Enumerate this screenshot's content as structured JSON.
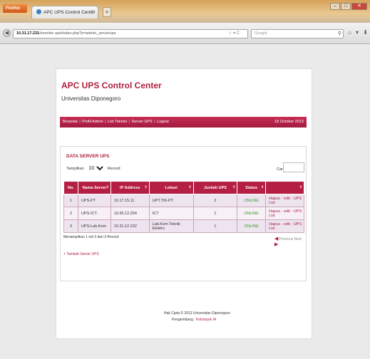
{
  "browser": {
    "app_button": "Firefox",
    "tab_title": "APC UPS Control Center",
    "tab_close": "×",
    "new_tab": "+",
    "url_host": "10.31.17.231",
    "url_path": "/monitor-ups/index.php?p=admin_serverups",
    "url_icons": "☆ ▾ C",
    "search_placeholder": "Google",
    "tool_icons": "⌂ ▾ ⬇"
  },
  "site": {
    "title": "APC UPS Control Center",
    "subtitle": "Universitas Diponegoro"
  },
  "menu": {
    "items": [
      "Beranda",
      "Profil Admin",
      "List Teknisi",
      "Server UPS",
      "Logout"
    ],
    "date": "18 October 2013"
  },
  "section": {
    "title": "DATA SERVER UPS",
    "show_label": "Tampilkan",
    "show_value": "10",
    "records_label": "Record",
    "search_label": "Cari:"
  },
  "table": {
    "headers": [
      "No.",
      "Nama Server",
      "IP Address",
      "Lokasi",
      "Jumlah UPS",
      "Status",
      ""
    ],
    "rows": [
      [
        "1",
        "UPS-PT",
        "10.17.15.11",
        "UPT.TIK-PT",
        "2",
        "ONLINE",
        "Hapus - edit - UPS List"
      ],
      [
        "2",
        "UPS-ICT",
        "10.65.12.254",
        "ICT",
        "1",
        "ONLINE",
        "Hapus - edit - UPS List"
      ],
      [
        "3",
        "UPS-Lab.Kom",
        "10.31.12.222",
        "Lab.Kom Teknik Elektro",
        "1",
        "ONLINE",
        "Hapus - edit - UPS List"
      ]
    ],
    "info": "Menampilkan 1 s/d 3 dari 3 Record",
    "prev": "Previous",
    "next": "Next"
  },
  "add_link": "+ Tambah Server UPS",
  "footer": {
    "copyright": "Hak Cipta © 2013 Universitas Diponegoro",
    "dev_label": "Pengembang :",
    "dev_name": "Kelompok IA"
  },
  "colors": {
    "accent": "#b51f44",
    "online": "#3a9a2a"
  }
}
